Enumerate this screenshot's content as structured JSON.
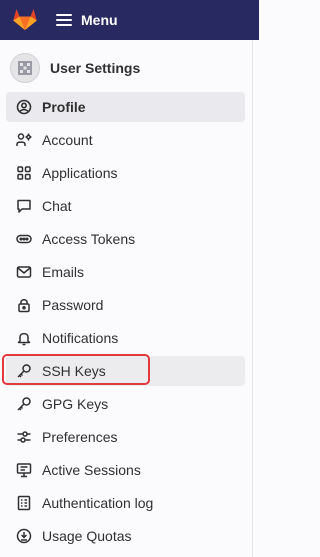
{
  "header": {
    "logo_icon": "gitlab-tanuki-icon",
    "menu_label": "Menu",
    "bg_color": "#292961"
  },
  "sidebar": {
    "scope_title": "User Settings",
    "items": [
      {
        "label": "Profile",
        "icon": "profile-icon",
        "state": "active"
      },
      {
        "label": "Account",
        "icon": "account-icon"
      },
      {
        "label": "Applications",
        "icon": "applications-icon"
      },
      {
        "label": "Chat",
        "icon": "chat-icon"
      },
      {
        "label": "Access Tokens",
        "icon": "token-icon"
      },
      {
        "label": "Emails",
        "icon": "mail-icon"
      },
      {
        "label": "Password",
        "icon": "lock-icon"
      },
      {
        "label": "Notifications",
        "icon": "bell-icon"
      },
      {
        "label": "SSH Keys",
        "icon": "key-icon",
        "state": "hover-highlighted"
      },
      {
        "label": "GPG Keys",
        "icon": "key-icon"
      },
      {
        "label": "Preferences",
        "icon": "preferences-icon"
      },
      {
        "label": "Active Sessions",
        "icon": "monitor-icon"
      },
      {
        "label": "Authentication log",
        "icon": "log-icon"
      },
      {
        "label": "Usage Quotas",
        "icon": "quota-icon"
      }
    ]
  },
  "colors": {
    "highlight_border": "#e03a3e",
    "active_bg": "#e9e9ee"
  }
}
